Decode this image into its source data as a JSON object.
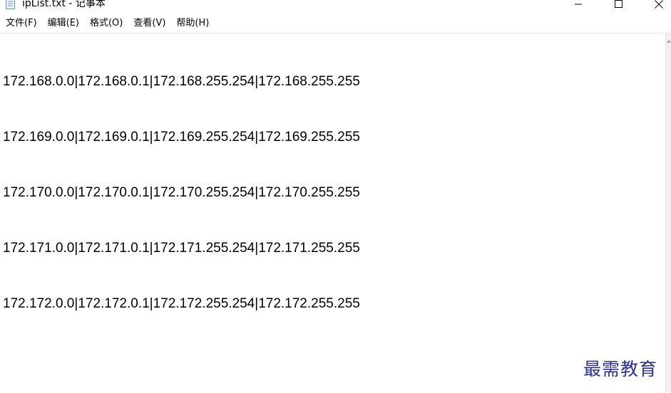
{
  "window": {
    "title": "ipList.txt - 记事本",
    "icon": "notepad-icon",
    "controls": [
      "minimize-icon",
      "maximize-icon",
      "close-icon"
    ]
  },
  "menu": {
    "items": [
      "文件(F)",
      "编辑(E)",
      "格式(O)",
      "查看(V)",
      "帮助(H)"
    ]
  },
  "editor": {
    "lines": [
      "172.168.0.0|172.168.0.1|172.168.255.254|172.168.255.255",
      "172.169.0.0|172.169.0.1|172.169.255.254|172.169.255.255",
      "172.170.0.0|172.170.0.1|172.170.255.254|172.170.255.255",
      "172.171.0.0|172.171.0.1|172.171.255.254|172.171.255.255",
      "172.172.0.0|172.172.0.1|172.172.255.254|172.172.255.255"
    ]
  },
  "watermark": {
    "text": "最需教育",
    "color": "#2d2d9a"
  }
}
